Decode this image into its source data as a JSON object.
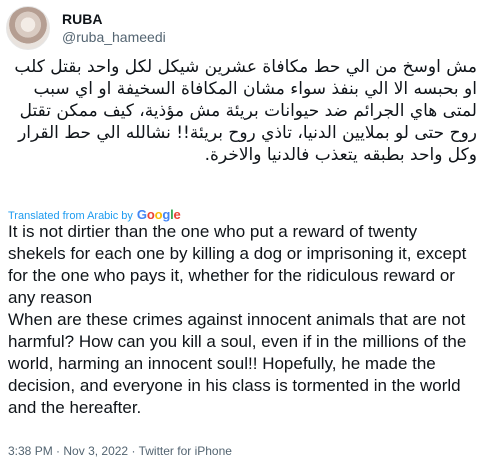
{
  "author": {
    "display_name": "RUBA",
    "handle": "@ruba_hameedi"
  },
  "tweet": {
    "arabic_paragraphs": [
      "مش اوسخ من الي حط مكافاة عشرين شيكل لكل واحد بقتل كلب او بحبسه الا الي بنفذ سواء مشان المكافاة السخيفة او اي سبب",
      "لمتى هاي الجرائم ضد حيوانات بريئة مش مؤذية، كيف ممكن تقتل روح حتى لو بملايين الدنيا، تاذي روح بريئة!! نشالله الي حط القرار وكل واحد بطبقه يتعذب فالدنيا والاخرة."
    ],
    "translation": {
      "label": "Translated from Arabic by",
      "provider": "Google",
      "provider_letters": [
        "G",
        "o",
        "o",
        "g",
        "l",
        "e"
      ]
    },
    "english_paragraphs": [
      "It is not dirtier than the one who put a reward of twenty shekels for each one by killing a dog or imprisoning it, except for the one who pays it, whether for the ridiculous reward or any reason",
      "When are these crimes against innocent animals that are not harmful? How can you kill a soul, even if in the millions of the world, harming an innocent soul!! Hopefully, he made the decision, and everyone in his class is tormented in the world and the hereafter."
    ],
    "time": "3:38 PM",
    "date": "Nov 3, 2022",
    "source": "Twitter for iPhone",
    "separator": "·"
  },
  "colors": {
    "link_blue": "#1d9bf0",
    "text": "#0f1419",
    "muted": "#536471"
  }
}
